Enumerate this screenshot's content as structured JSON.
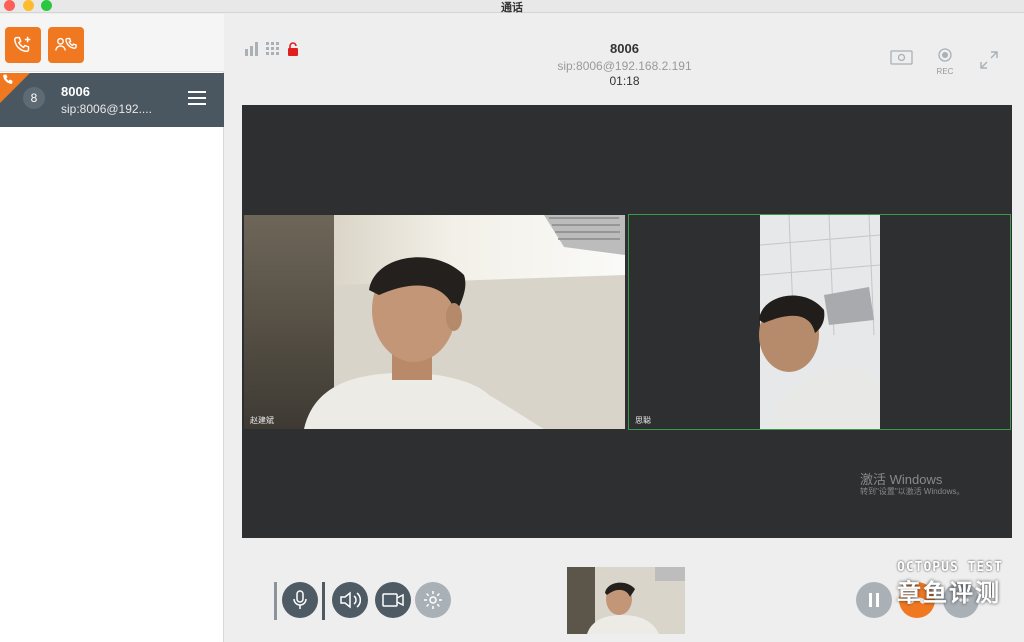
{
  "window": {
    "title": "通话"
  },
  "colors": {
    "accent": "#f07820",
    "sidebar_item_bg": "#4a5660",
    "video_bg": "#2e2f30",
    "tile_border_active": "#3a9a4a"
  },
  "sidebar": {
    "toolbar": [
      {
        "icon": "add-call-icon"
      },
      {
        "icon": "conference-call-icon"
      }
    ],
    "calls": [
      {
        "avatar_text": "8",
        "name": "8006",
        "sip": "sip:8006@192....",
        "icon": "incoming-call-icon",
        "menu_icon": "hamburger-menu-icon"
      }
    ]
  },
  "call_header": {
    "name": "8006",
    "sip": "sip:8006@192.168.2.191",
    "duration": "01:18",
    "left_icons": [
      "signal-bars-icon",
      "dialpad-grid-icon",
      "unlock-icon"
    ],
    "right_icons": [
      "screen-share-icon",
      "record-icon",
      "fullscreen-icon"
    ],
    "rec_label": "REC"
  },
  "video": {
    "tiles": [
      {
        "label": "赵建斌",
        "active": false
      },
      {
        "label": "思聪",
        "active": true
      }
    ],
    "os_watermark": {
      "line1": "激活 Windows",
      "line2": "转到\"设置\"以激活 Windows。"
    }
  },
  "controls": {
    "left": [
      "microphone-icon",
      "speaker-icon",
      "camera-icon",
      "settings-icon"
    ],
    "right": [
      "pause-icon",
      "hangup-icon",
      "more-icon"
    ]
  },
  "brand_watermark": {
    "en": "OCTOPUS TEST",
    "cn": "章鱼评测"
  }
}
